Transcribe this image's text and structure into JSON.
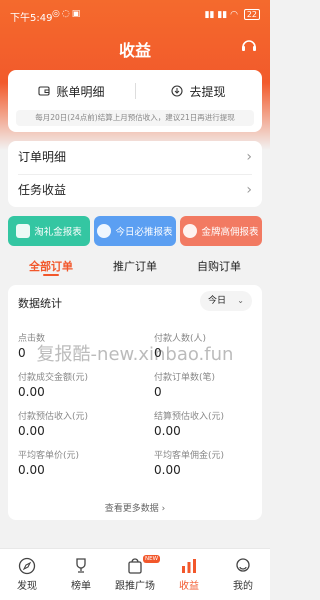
{
  "status_bar": {
    "time": "下午5:49",
    "battery": "22"
  },
  "header": {
    "title": "收益"
  },
  "actions": {
    "detail": "账单明细",
    "withdraw": "去提现"
  },
  "notice": "每月20日(24点前)结算上月预估收入，建议21日再进行提现",
  "menu": {
    "orders": "订单明细",
    "earnings": "任务收益"
  },
  "quick": [
    {
      "label": "淘礼金报表",
      "color": "#34c6a2"
    },
    {
      "label": "今日必推报表",
      "color": "#5b9ff2"
    },
    {
      "label": "金牌高佣报表",
      "color": "#f27a62"
    }
  ],
  "tabs": [
    {
      "label": "全部订单",
      "active": true
    },
    {
      "label": "推广订单",
      "active": false
    },
    {
      "label": "自购订单",
      "active": false
    }
  ],
  "stats": {
    "title": "数据统计",
    "range": "今日",
    "metrics": [
      {
        "label": "点击数",
        "value": "0"
      },
      {
        "label": "付款人数(人)",
        "value": "0"
      },
      {
        "label": "付款成交金额(元)",
        "value": "0.00"
      },
      {
        "label": "付款订单数(笔)",
        "value": "0"
      },
      {
        "label": "付款预估收入(元)",
        "value": "0.00"
      },
      {
        "label": "结算预估收入(元)",
        "value": "0.00"
      },
      {
        "label": "平均客单价(元)",
        "value": "0.00"
      },
      {
        "label": "平均客单佣金(元)",
        "value": "0.00"
      }
    ],
    "more": "查看更多数据"
  },
  "watermark": "复报酷-new.xinbao.fun",
  "nav": [
    {
      "label": "发现",
      "icon": "compass-icon"
    },
    {
      "label": "榜单",
      "icon": "trophy-icon"
    },
    {
      "label": "跟推广场",
      "icon": "bag-icon"
    },
    {
      "label": "收益",
      "icon": "chart-icon"
    },
    {
      "label": "我的",
      "icon": "user-icon"
    }
  ],
  "nav_badge": "NEW",
  "colors": {
    "accent": "#f2572b"
  }
}
